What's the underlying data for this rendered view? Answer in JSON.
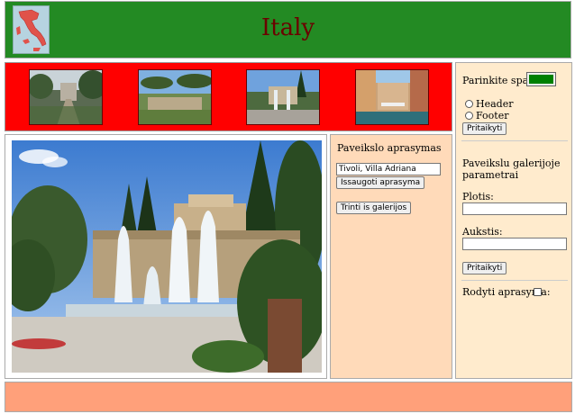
{
  "header": {
    "title": "Italy",
    "logo_icon": "italy-map-icon",
    "background": "#238a23",
    "title_color": "#6b0000"
  },
  "gallery": {
    "background": "#ff0000",
    "thumbnails": [
      {
        "name": "thumb-villa-path"
      },
      {
        "name": "thumb-garden-ruins"
      },
      {
        "name": "thumb-fountain"
      },
      {
        "name": "thumb-venice-canal"
      }
    ]
  },
  "description_panel": {
    "label": "Paveikslo aprasymas",
    "input_value": "Tivoli, Villa Adriana",
    "save_button": "Issaugoti aprasyma",
    "remove_button": "Trinti is galerijos",
    "background": "#ffdab9"
  },
  "settings": {
    "color_label": "Parinkite spalva",
    "color_value": "#008000",
    "radio_options": [
      "Header",
      "Footer"
    ],
    "apply_button_1": "Pritaikyti",
    "gallery_params_label": "Paveikslu galerijoje parametrai",
    "width_label": "Plotis:",
    "height_label": "Aukstis:",
    "apply_button_2": "Pritaikyti",
    "show_desc_label": "Rodyti aprasyma:",
    "background": "#ffebcd"
  },
  "footer": {
    "background": "#ffa07a"
  }
}
